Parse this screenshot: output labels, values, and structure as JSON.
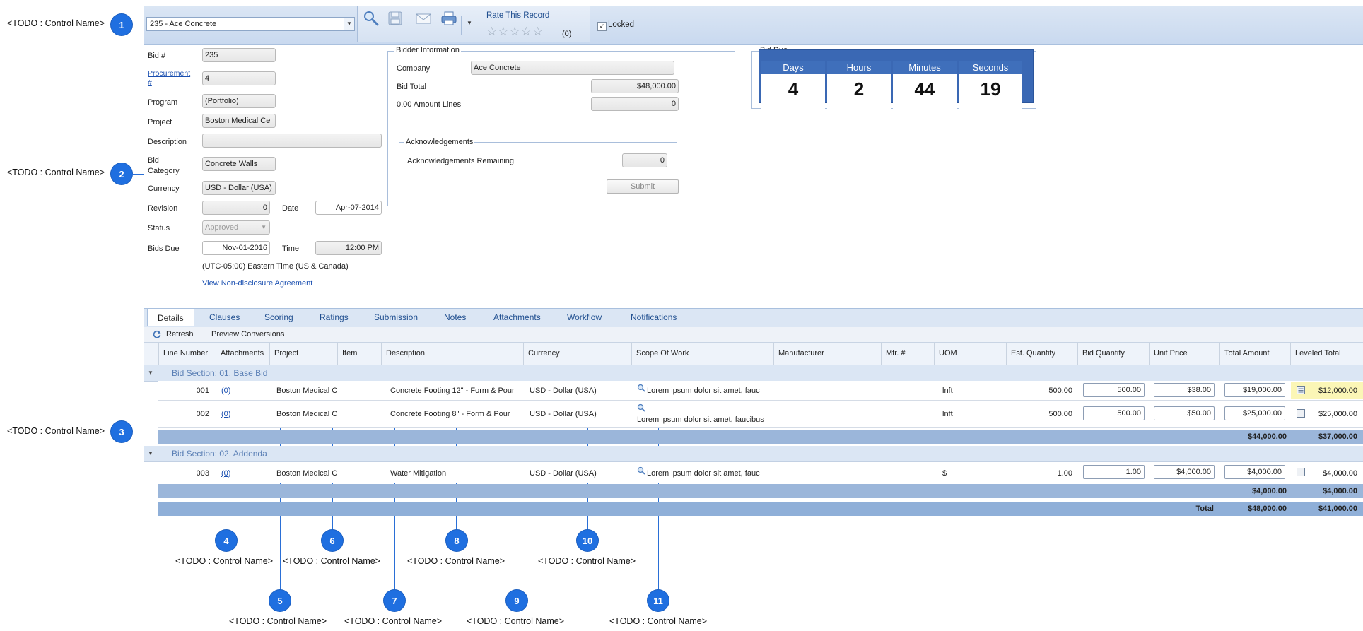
{
  "callout_label": "<TODO : Control Name>",
  "callouts": [
    "1",
    "2",
    "3",
    "4",
    "5",
    "6",
    "7",
    "8",
    "9",
    "10",
    "11"
  ],
  "header": {
    "record": "235 - Ace Concrete",
    "rate_title": "Rate This Record",
    "stars": "☆☆☆☆☆",
    "rate_count": "(0)",
    "locked_label": "Locked",
    "locked_checked": "✓",
    "icons": [
      "search-icon",
      "save-icon",
      "email-icon",
      "print-icon"
    ]
  },
  "form": {
    "bid_no_label": "Bid #",
    "bid_no": "235",
    "procurement_label_1": "Procurement",
    "procurement_label_2": "#",
    "procurement": "4",
    "program_label": "Program",
    "program": "(Portfolio)",
    "project_label": "Project",
    "project": "Boston Medical Ce",
    "description_label": "Description",
    "description": "",
    "bid_category_label_1": "Bid",
    "bid_category_label_2": "Category",
    "bid_category": "Concrete Walls",
    "currency_label": "Currency",
    "currency": "USD - Dollar (USA)",
    "revision_label": "Revision",
    "revision": "0",
    "date_label": "Date",
    "date": "Apr-07-2014",
    "status_label": "Status",
    "status": "Approved",
    "bids_due_label": "Bids Due",
    "bids_due": "Nov-01-2016",
    "time_label": "Time",
    "time": "12:00 PM",
    "timezone": "(UTC-05:00) Eastern Time (US & Canada)",
    "nda_link": "View Non-disclosure Agreement"
  },
  "bidder": {
    "title": "Bidder Information",
    "company_label": "Company",
    "company": "Ace Concrete",
    "bid_total_label": "Bid Total",
    "bid_total": "$48,000.00",
    "amount_lines_label": "0.00 Amount Lines",
    "amount_lines": "0",
    "ack_title": "Acknowledgements",
    "ack_remaining_label": "Acknowledgements Remaining",
    "ack_remaining": "0",
    "submit": "Submit"
  },
  "bid_due": {
    "title": "Bid Due",
    "units": [
      {
        "label": "Days",
        "value": "4"
      },
      {
        "label": "Hours",
        "value": "2"
      },
      {
        "label": "Minutes",
        "value": "44"
      },
      {
        "label": "Seconds",
        "value": "19"
      }
    ]
  },
  "tabs": [
    "Details",
    "Clauses",
    "Scoring",
    "Ratings",
    "Submission",
    "Notes",
    "Attachments",
    "Workflow",
    "Notifications"
  ],
  "toolbar": {
    "refresh": "Refresh",
    "preview": "Preview Conversions"
  },
  "grid": {
    "columns": [
      "Line Number",
      "Attachments",
      "Project",
      "Item",
      "Description",
      "Currency",
      "Scope Of Work",
      "Manufacturer",
      "Mfr. #",
      "UOM",
      "Est. Quantity",
      "Bid Quantity",
      "Unit Price",
      "Total Amount",
      "Leveled Total"
    ],
    "sections": [
      {
        "title": "Bid Section: 01. Base Bid",
        "rows": [
          {
            "line": "001",
            "att": "(0)",
            "project": "Boston Medical C",
            "description": "Concrete Footing 12\" - Form & Pour",
            "currency": "USD - Dollar (USA)",
            "scope": "Lorem ipsum dolor sit amet, fauc",
            "uom": "lnft",
            "est": "500.00",
            "qty": "500.00",
            "price": "$38.00",
            "total": "$19,000.00",
            "leveled": "$12,000.00"
          },
          {
            "line": "002",
            "att": "(0)",
            "project": "Boston Medical C",
            "description": "Concrete Footing 8\" - Form & Pour",
            "currency": "USD - Dollar (USA)",
            "scope": "Lorem ipsum dolor sit amet, faucibus",
            "uom": "lnft",
            "est": "500.00",
            "qty": "500.00",
            "price": "$50.00",
            "total": "$25,000.00",
            "leveled": "$25,000.00"
          }
        ],
        "subtotal_total": "$44,000.00",
        "subtotal_leveled": "$37,000.00"
      },
      {
        "title": "Bid Section: 02. Addenda",
        "rows": [
          {
            "line": "003",
            "att": "(0)",
            "project": "Boston Medical C",
            "description": "Water Mitigation",
            "currency": "USD - Dollar (USA)",
            "scope": "Lorem ipsum dolor sit amet, fauc",
            "uom": "$",
            "est": "1.00",
            "qty": "1.00",
            "price": "$4,000.00",
            "total": "$4,000.00",
            "leveled": "$4,000.00"
          }
        ],
        "subtotal_total": "$4,000.00",
        "subtotal_leveled": "$4,000.00"
      }
    ],
    "grand_label": "Total",
    "grand_total": "$48,000.00",
    "grand_leveled": "$41,000.00"
  }
}
